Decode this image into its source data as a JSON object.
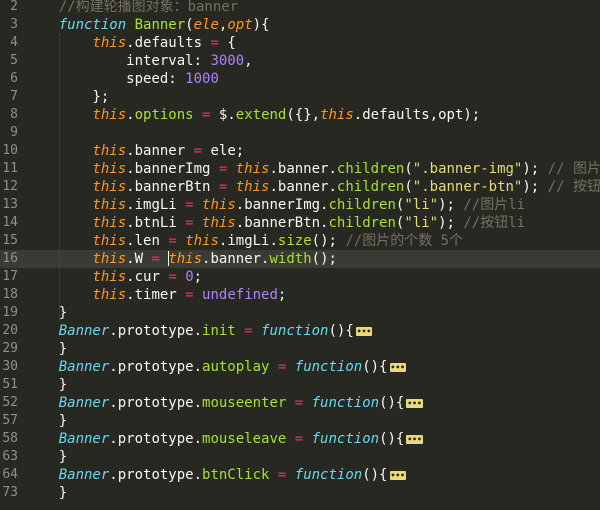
{
  "editor": {
    "theme_colors": {
      "background": "#272822",
      "comment": "#75715e",
      "keyword": "#66d9ef",
      "this": "#fd971f",
      "function": "#a6e22e",
      "string": "#e6db74",
      "number": "#ae81ff",
      "operator": "#f92672"
    },
    "active_line": "16",
    "lines": [
      {
        "n": "2",
        "tokens": [
          [
            "comment",
            "    //构建轮播图对象：banner"
          ]
        ]
      },
      {
        "n": "3",
        "tokens": [
          [
            "",
            "    "
          ],
          [
            "kw",
            "function"
          ],
          [
            "",
            " "
          ],
          [
            "fn",
            "Banner"
          ],
          [
            "",
            "("
          ],
          [
            "param",
            "ele"
          ],
          [
            "",
            ","
          ],
          [
            "param",
            "opt"
          ],
          [
            "",
            "){"
          ]
        ]
      },
      {
        "n": "4",
        "tokens": [
          [
            "",
            "        "
          ],
          [
            "this",
            "this"
          ],
          [
            "",
            ".defaults "
          ],
          [
            "op",
            "="
          ],
          [
            "",
            " {"
          ]
        ]
      },
      {
        "n": "5",
        "tokens": [
          [
            "",
            "            interval: "
          ],
          [
            "num",
            "3000"
          ],
          [
            "",
            ","
          ]
        ]
      },
      {
        "n": "6",
        "tokens": [
          [
            "",
            "            speed: "
          ],
          [
            "num",
            "1000"
          ]
        ]
      },
      {
        "n": "7",
        "tokens": [
          [
            "",
            "        };"
          ]
        ]
      },
      {
        "n": "8",
        "tokens": [
          [
            "",
            "        "
          ],
          [
            "this",
            "this"
          ],
          [
            "",
            "."
          ],
          [
            "fn",
            "options"
          ],
          [
            "",
            " "
          ],
          [
            "op",
            "="
          ],
          [
            "",
            " $."
          ],
          [
            "fn",
            "extend"
          ],
          [
            "",
            "({},"
          ],
          [
            "this",
            "this"
          ],
          [
            "",
            ".defaults,opt);"
          ]
        ]
      },
      {
        "n": "9",
        "tokens": []
      },
      {
        "n": "10",
        "tokens": [
          [
            "",
            "        "
          ],
          [
            "this",
            "this"
          ],
          [
            "",
            ".banner "
          ],
          [
            "op",
            "="
          ],
          [
            "",
            " ele;"
          ]
        ]
      },
      {
        "n": "11",
        "tokens": [
          [
            "",
            "        "
          ],
          [
            "this",
            "this"
          ],
          [
            "",
            ".bannerImg "
          ],
          [
            "op",
            "="
          ],
          [
            "",
            " "
          ],
          [
            "this",
            "this"
          ],
          [
            "",
            ".banner."
          ],
          [
            "fn",
            "children"
          ],
          [
            "",
            "("
          ],
          [
            "str",
            "\".banner-img\""
          ],
          [
            "",
            "); "
          ],
          [
            "comment",
            "// 图片ul"
          ]
        ]
      },
      {
        "n": "12",
        "tokens": [
          [
            "",
            "        "
          ],
          [
            "this",
            "this"
          ],
          [
            "",
            ".bannerBtn "
          ],
          [
            "op",
            "="
          ],
          [
            "",
            " "
          ],
          [
            "this",
            "this"
          ],
          [
            "",
            ".banner."
          ],
          [
            "fn",
            "children"
          ],
          [
            "",
            "("
          ],
          [
            "str",
            "\".banner-btn\""
          ],
          [
            "",
            "); "
          ],
          [
            "comment",
            "// 按钮ul"
          ]
        ]
      },
      {
        "n": "13",
        "tokens": [
          [
            "",
            "        "
          ],
          [
            "this",
            "this"
          ],
          [
            "",
            ".imgLi "
          ],
          [
            "op",
            "="
          ],
          [
            "",
            " "
          ],
          [
            "this",
            "this"
          ],
          [
            "",
            ".bannerImg."
          ],
          [
            "fn",
            "children"
          ],
          [
            "",
            "("
          ],
          [
            "str",
            "\"li\""
          ],
          [
            "",
            "); "
          ],
          [
            "comment",
            "//图片li"
          ]
        ]
      },
      {
        "n": "14",
        "tokens": [
          [
            "",
            "        "
          ],
          [
            "this",
            "this"
          ],
          [
            "",
            ".btnLi "
          ],
          [
            "op",
            "="
          ],
          [
            "",
            " "
          ],
          [
            "this",
            "this"
          ],
          [
            "",
            ".bannerBtn."
          ],
          [
            "fn",
            "children"
          ],
          [
            "",
            "("
          ],
          [
            "str",
            "\"li\""
          ],
          [
            "",
            "); "
          ],
          [
            "comment",
            "//按钮li"
          ]
        ]
      },
      {
        "n": "15",
        "tokens": [
          [
            "",
            "        "
          ],
          [
            "this",
            "this"
          ],
          [
            "",
            ".len "
          ],
          [
            "op",
            "="
          ],
          [
            "",
            " "
          ],
          [
            "this",
            "this"
          ],
          [
            "",
            ".imgLi."
          ],
          [
            "fn",
            "size"
          ],
          [
            "",
            "(); "
          ],
          [
            "comment",
            "//图片的个数 5个"
          ]
        ]
      },
      {
        "n": "16",
        "tokens": [
          [
            "",
            "        "
          ],
          [
            "this",
            "this"
          ],
          [
            "",
            ".W "
          ],
          [
            "op",
            "="
          ],
          [
            "",
            " "
          ],
          [
            "caret",
            ""
          ],
          [
            "this",
            "this"
          ],
          [
            "",
            ".banner."
          ],
          [
            "fn",
            "width"
          ],
          [
            "",
            "();"
          ]
        ]
      },
      {
        "n": "17",
        "tokens": [
          [
            "",
            "        "
          ],
          [
            "this",
            "this"
          ],
          [
            "",
            ".cur "
          ],
          [
            "op",
            "="
          ],
          [
            "",
            " "
          ],
          [
            "num",
            "0"
          ],
          [
            "",
            ";"
          ]
        ]
      },
      {
        "n": "18",
        "tokens": [
          [
            "",
            "        "
          ],
          [
            "this",
            "this"
          ],
          [
            "",
            ".timer "
          ],
          [
            "op",
            "="
          ],
          [
            "",
            " "
          ],
          [
            "num",
            "undefined"
          ],
          [
            "",
            ";"
          ]
        ]
      },
      {
        "n": "19",
        "tokens": [
          [
            "",
            "    }"
          ]
        ]
      },
      {
        "n": "20",
        "tokens": [
          [
            "",
            "    "
          ],
          [
            "cls",
            "Banner"
          ],
          [
            "",
            ".prototype."
          ],
          [
            "fn",
            "init"
          ],
          [
            "",
            " "
          ],
          [
            "op",
            "="
          ],
          [
            "",
            " "
          ],
          [
            "kw",
            "function"
          ],
          [
            "",
            "(){"
          ],
          [
            "fold",
            "•••"
          ]
        ]
      },
      {
        "n": "29",
        "tokens": [
          [
            "",
            "    }"
          ]
        ]
      },
      {
        "n": "30",
        "tokens": [
          [
            "",
            "    "
          ],
          [
            "cls",
            "Banner"
          ],
          [
            "",
            ".prototype."
          ],
          [
            "fn",
            "autoplay"
          ],
          [
            "",
            " "
          ],
          [
            "op",
            "="
          ],
          [
            "",
            " "
          ],
          [
            "kw",
            "function"
          ],
          [
            "",
            "(){"
          ],
          [
            "fold",
            "•••"
          ]
        ]
      },
      {
        "n": "51",
        "tokens": [
          [
            "",
            "    }"
          ]
        ]
      },
      {
        "n": "52",
        "tokens": [
          [
            "",
            "    "
          ],
          [
            "cls",
            "Banner"
          ],
          [
            "",
            ".prototype."
          ],
          [
            "fn",
            "mouseenter"
          ],
          [
            "",
            " "
          ],
          [
            "op",
            "="
          ],
          [
            "",
            " "
          ],
          [
            "kw",
            "function"
          ],
          [
            "",
            "(){"
          ],
          [
            "fold",
            "•••"
          ]
        ]
      },
      {
        "n": "57",
        "tokens": [
          [
            "",
            "    }"
          ]
        ]
      },
      {
        "n": "58",
        "tokens": [
          [
            "",
            "    "
          ],
          [
            "cls",
            "Banner"
          ],
          [
            "",
            ".prototype."
          ],
          [
            "fn",
            "mouseleave"
          ],
          [
            "",
            " "
          ],
          [
            "op",
            "="
          ],
          [
            "",
            " "
          ],
          [
            "kw",
            "function"
          ],
          [
            "",
            "(){"
          ],
          [
            "fold",
            "•••"
          ]
        ]
      },
      {
        "n": "63",
        "tokens": [
          [
            "",
            "    }"
          ]
        ]
      },
      {
        "n": "64",
        "tokens": [
          [
            "",
            "    "
          ],
          [
            "cls",
            "Banner"
          ],
          [
            "",
            ".prototype."
          ],
          [
            "fn",
            "btnClick"
          ],
          [
            "",
            " "
          ],
          [
            "op",
            "="
          ],
          [
            "",
            " "
          ],
          [
            "kw",
            "function"
          ],
          [
            "",
            "(){"
          ],
          [
            "fold",
            "•••"
          ]
        ]
      },
      {
        "n": "73",
        "tokens": [
          [
            "",
            "    }"
          ]
        ]
      }
    ]
  }
}
